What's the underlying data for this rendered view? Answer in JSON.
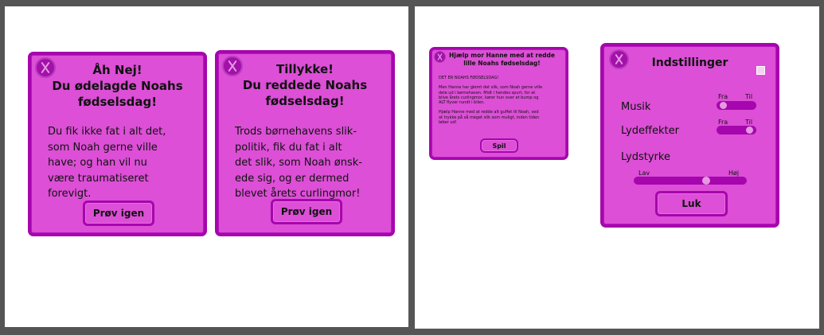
{
  "panel_lose": {
    "title_lines": [
      "Åh Nej!",
      "Du ødelagde Noahs",
      "fødselsdag!"
    ],
    "body_lines": [
      "Du fik ikke fat i alt det,",
      "som Noah gerne ville",
      "have; og han vil nu",
      "være traumatiseret",
      "forevigt."
    ],
    "button_label": "Prøv igen"
  },
  "panel_win": {
    "title_lines": [
      "Tillykke!",
      "Du reddede Noahs",
      "fødselsdag!"
    ],
    "body_lines": [
      "Trods børnehavens slik-",
      "politik, fik du fat i alt",
      "det slik, som Noah ønsk-",
      "ede sig, og er dermed",
      "blevet årets curlingmor!"
    ],
    "button_label": "Prøv igen"
  },
  "panel_intro": {
    "title_lines": [
      "Hjælp mor Hanne med at redde",
      "lille Noahs fødselsdag!"
    ],
    "paragraphs": [
      [
        "DET ER NOAHS FØDSELSDAG!"
      ],
      [
        "Men Hanne har glemt det slik, som Noah gerne ville",
        "dele ud i børnehaven. Midt i hendes spurt, for at",
        "blive årets curlingmor, kører hun over et bump og",
        "ALT flyver rundt i bilen."
      ],
      [
        "Hjælp Hanne med at redde alt guffet til Noah, ved",
        "at trykke på så meget slik som muligt, inden tiden",
        "løber ud!"
      ]
    ],
    "button_label": "Spil"
  },
  "panel_settings": {
    "title": "Indstillinger",
    "music_label": "Musik",
    "sfx_label": "Lydeffekter",
    "volume_label": "Lydstyrke",
    "off_label": "Fra",
    "on_label": "Til",
    "low_label": "Lav",
    "high_label": "Høj",
    "music_state": "Fra",
    "sfx_state": "Til",
    "volume_level": 0.65,
    "close_label": "Luk"
  },
  "colors": {
    "panel_fill": "#dc4fd6",
    "panel_border": "#a606ad",
    "knob": "#e49ae0",
    "background": "#555555"
  },
  "icons": {
    "close": "close-x-icon",
    "checkbox": "checkbox-icon"
  }
}
